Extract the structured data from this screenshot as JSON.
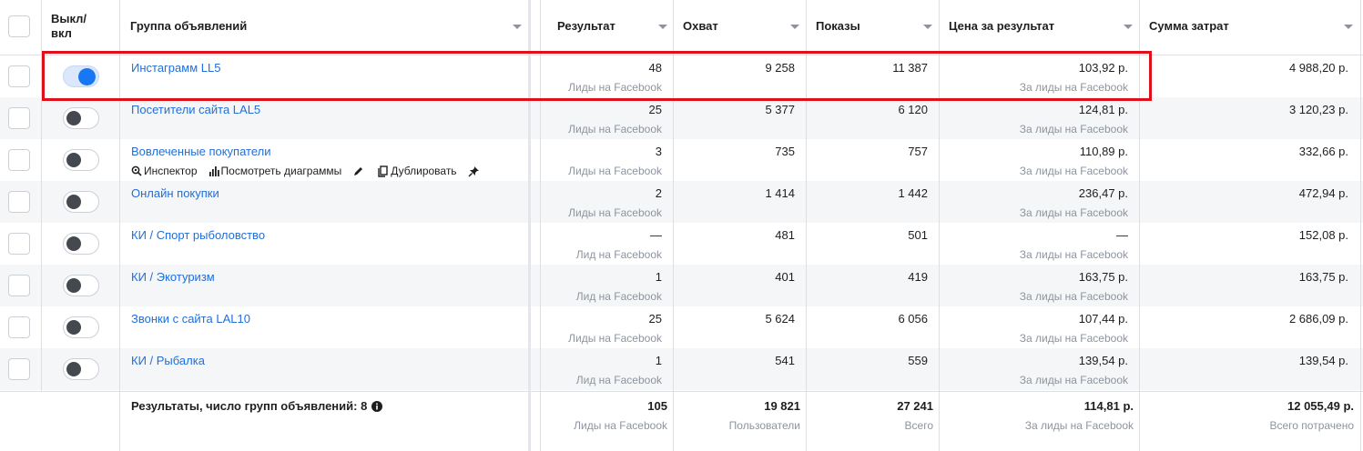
{
  "header": {
    "toggle_col": "Выкл/\nвкл",
    "name_col": "Группа объявлений",
    "result_col": "Результат",
    "reach_col": "Охват",
    "impressions_col": "Показы",
    "cpr_col": "Цена за результат",
    "spend_col": "Сумма затрат"
  },
  "row_actions": {
    "inspector": "Инспектор",
    "charts": "Посмотреть диаграммы",
    "duplicate": "Дублировать"
  },
  "rows": [
    {
      "name": "Инстаграмм LL5",
      "on": true,
      "result": "48",
      "result_sub": "Лиды на Facebook",
      "reach": "9 258",
      "impressions": "11 387",
      "cpr": "103,92 р.",
      "cpr_sub": "За лиды на Facebook",
      "spend": "4 988,20 р."
    },
    {
      "name": "Посетители сайта LAL5",
      "on": false,
      "result": "25",
      "result_sub": "Лиды на Facebook",
      "reach": "5 377",
      "impressions": "6 120",
      "cpr": "124,81 р.",
      "cpr_sub": "За лиды на Facebook",
      "spend": "3 120,23 р."
    },
    {
      "name": "Вовлеченные покупатели",
      "on": false,
      "result": "3",
      "result_sub": "Лиды на Facebook",
      "reach": "735",
      "impressions": "757",
      "cpr": "110,89 р.",
      "cpr_sub": "За лиды на Facebook",
      "spend": "332,66 р."
    },
    {
      "name": "Онлайн покупки",
      "on": false,
      "result": "2",
      "result_sub": "Лиды на Facebook",
      "reach": "1 414",
      "impressions": "1 442",
      "cpr": "236,47 р.",
      "cpr_sub": "За лиды на Facebook",
      "spend": "472,94 р."
    },
    {
      "name": "КИ / Спорт рыболовство",
      "on": false,
      "result": "—",
      "result_sub": "Лид на Facebook",
      "reach": "481",
      "impressions": "501",
      "cpr": "—",
      "cpr_sub": "За лиды на Facebook",
      "spend": "152,08 р."
    },
    {
      "name": "КИ / Экотуризм",
      "on": false,
      "result": "1",
      "result_sub": "Лид на Facebook",
      "reach": "401",
      "impressions": "419",
      "cpr": "163,75 р.",
      "cpr_sub": "За лиды на Facebook",
      "spend": "163,75 р."
    },
    {
      "name": "Звонки с сайта LAL10",
      "on": false,
      "result": "25",
      "result_sub": "Лиды на Facebook",
      "reach": "5 624",
      "impressions": "6 056",
      "cpr": "107,44 р.",
      "cpr_sub": "За лиды на Facebook",
      "spend": "2 686,09 р."
    },
    {
      "name": "КИ / Рыбалка",
      "on": false,
      "result": "1",
      "result_sub": "Лид на Facebook",
      "reach": "541",
      "impressions": "559",
      "cpr": "139,54 р.",
      "cpr_sub": "За лиды на Facebook",
      "spend": "139,54 р."
    }
  ],
  "totals": {
    "label": "Результаты, число групп объявлений: 8",
    "result": "105",
    "result_sub": "Лиды на Facebook",
    "reach": "19 821",
    "reach_sub": "Пользователи",
    "impressions": "27 241",
    "impressions_sub": "Всего",
    "cpr": "114,81 р.",
    "cpr_sub": "За лиды на Facebook",
    "spend": "12 055,49 р.",
    "spend_sub": "Всего потрачено"
  },
  "colors": {
    "link": "#216fdb",
    "toggle_on": "#1877f2",
    "highlight": "#e0101a",
    "muted": "#8d949e",
    "row_alt": "#f5f6f7"
  }
}
